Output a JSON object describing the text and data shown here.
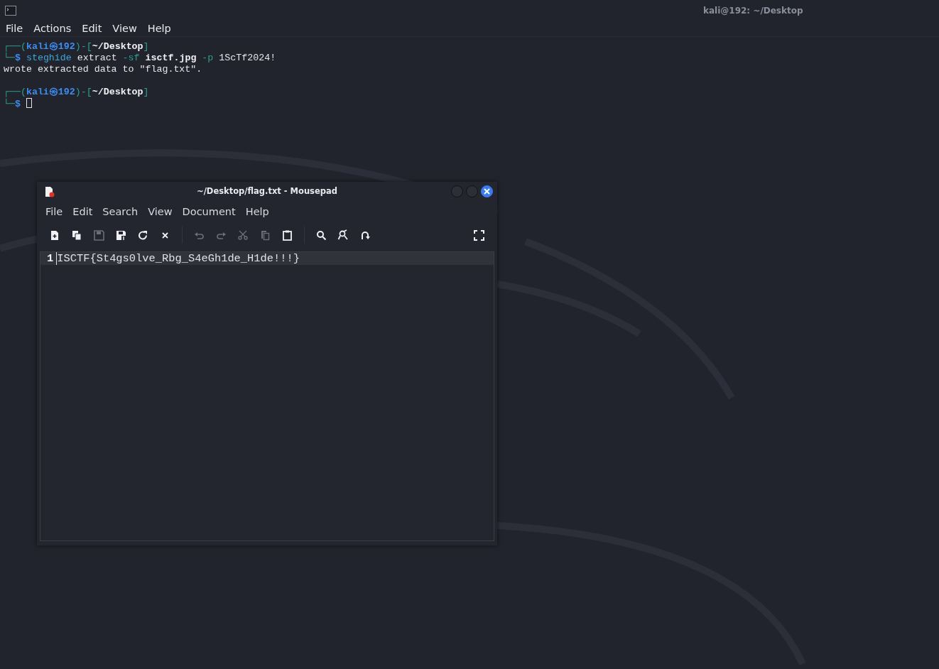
{
  "terminal": {
    "title": "kali@192: ~/Desktop",
    "menu": [
      "File",
      "Actions",
      "Edit",
      "View",
      "Help"
    ],
    "lines": [
      {
        "kind": "prompt",
        "top_left": "┌──(",
        "user": "kali",
        "at": "㉿",
        "host": "192",
        "mid": ")-[",
        "cwd": "~/Desktop",
        "end": "]",
        "bottom": "└─",
        "symbol": "$",
        "cursor": false,
        "command": [
          {
            "text": "steghide",
            "kind": "program"
          },
          {
            "text": "extract",
            "kind": "word"
          },
          {
            "text": "-sf",
            "kind": "option"
          },
          {
            "text": "isctf.jpg",
            "kind": "file"
          },
          {
            "text": "-p",
            "kind": "option"
          },
          {
            "text": "1ScTf2024!",
            "kind": "word"
          }
        ]
      },
      {
        "kind": "output",
        "text": "wrote extracted data to \"flag.txt\"."
      },
      {
        "kind": "blank"
      },
      {
        "kind": "prompt",
        "top_left": "┌──(",
        "user": "kali",
        "at": "㉿",
        "host": "192",
        "mid": ")-[",
        "cwd": "~/Desktop",
        "end": "]",
        "bottom": "└─",
        "symbol": "$",
        "cursor": true
      }
    ]
  },
  "editor": {
    "title": "~/Desktop/flag.txt - Mousepad",
    "menu": [
      "File",
      "Edit",
      "Search",
      "View",
      "Document",
      "Help"
    ],
    "toolbar": [
      {
        "kind": "new",
        "disabled": false
      },
      {
        "kind": "new-window",
        "disabled": false
      },
      {
        "kind": "save",
        "disabled": true
      },
      {
        "kind": "save-as",
        "disabled": false
      },
      {
        "kind": "reload",
        "disabled": false
      },
      {
        "kind": "close",
        "disabled": false
      },
      {
        "kind": "separator"
      },
      {
        "kind": "undo",
        "disabled": true
      },
      {
        "kind": "redo",
        "disabled": true
      },
      {
        "kind": "cut",
        "disabled": true
      },
      {
        "kind": "copy",
        "disabled": true
      },
      {
        "kind": "paste",
        "disabled": false
      },
      {
        "kind": "separator"
      },
      {
        "kind": "find",
        "disabled": false
      },
      {
        "kind": "replace",
        "disabled": false
      },
      {
        "kind": "goto",
        "disabled": false
      },
      {
        "kind": "spacer"
      },
      {
        "kind": "fullscreen",
        "disabled": false
      }
    ],
    "lines": [
      {
        "number": "1",
        "text": "ISCTF{St4gs0lve_Rbg_S4eGh1de_H1de!!!}",
        "current": true
      }
    ]
  }
}
